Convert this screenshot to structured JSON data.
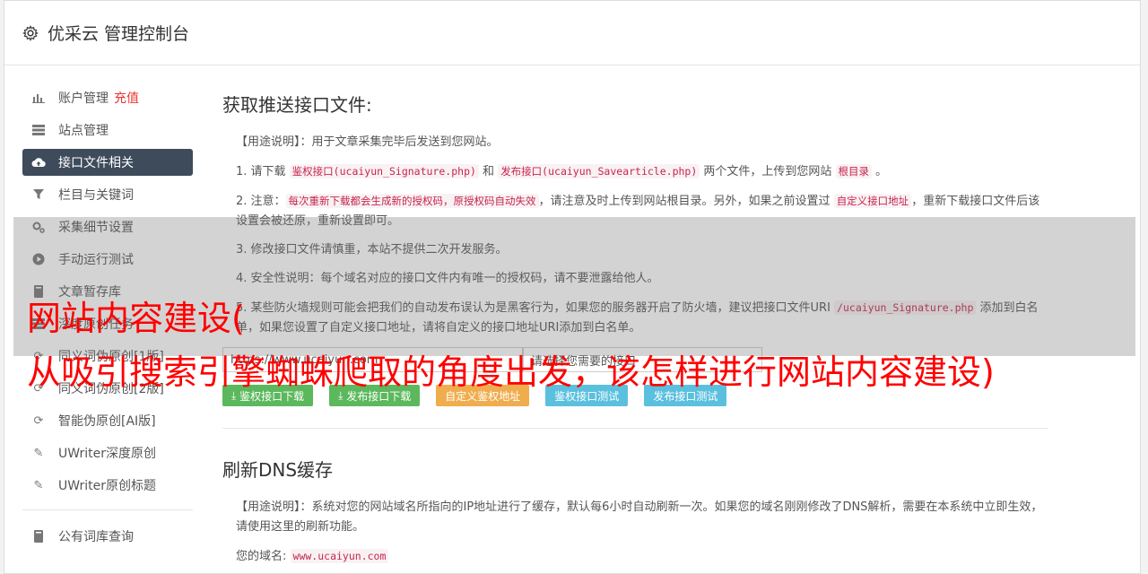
{
  "header": {
    "title": "优采云 管理控制台"
  },
  "sidebar": {
    "items": [
      {
        "label": "账户管理",
        "extra": "充值",
        "icon": "bar-chart-icon"
      },
      {
        "label": "站点管理",
        "icon": "server-icon"
      },
      {
        "label": "接口文件相关",
        "icon": "cloud-upload-icon",
        "active": true
      },
      {
        "label": "栏目与关键词",
        "icon": "filter-icon"
      },
      {
        "label": "采集细节设置",
        "icon": "cogs-icon"
      },
      {
        "label": "手动运行测试",
        "icon": "play-circle-icon"
      },
      {
        "label": "文章暂存库",
        "icon": "book-icon"
      },
      {
        "label": "深度原创任务",
        "icon": "tasks-icon"
      },
      {
        "label": "同义词伪原创[1版]",
        "icon": "refresh-icon"
      },
      {
        "label": "同义词伪原创[2版]",
        "icon": "refresh-icon"
      },
      {
        "label": "智能伪原创[AI版]",
        "icon": "refresh-icon"
      },
      {
        "label": "UWriter深度原创",
        "icon": "edit-icon"
      },
      {
        "label": "UWriter原创标题",
        "icon": "edit-icon"
      },
      {
        "label": "公有词库查询",
        "icon": "book-icon"
      }
    ]
  },
  "section1": {
    "title": "获取推送接口文件:",
    "usage": "【用途说明】：用于文章采集完毕后发送到您网站。",
    "p1": {
      "a": "1. 请下载 ",
      "code1": "鉴权接口(ucaiyun_Signature.php)",
      "b": " 和 ",
      "code2": "发布接口(ucaiyun_Savearticle.php)",
      "c": " 两个文件，上传到您网站 ",
      "code3": "根目录",
      "d": " 。"
    },
    "p2": {
      "a": "2. 注意：",
      "code1": "每次重新下载都会生成新的授权码，原授权码自动失效",
      "b": "，请注意及时上传到网站根目录。另外，如果之前设置过 ",
      "code2": "自定义接口地址",
      "c": "，重新下载接口文件后该设置会被还原，重新设置即可。"
    },
    "p3": "3. 修改接口文件请慎重，本站不提供二次开发服务。",
    "p4": "4. 安全性说明：每个域名对应的接口文件内有唯一的授权码，请不要泄露给他人。",
    "p5": {
      "a": "5. 某些防火墙规则可能会把我们的自动发布误认为是黑客行为，如果您的服务器开启了防火墙，建议把接口文件URI ",
      "code1": "/ucaiyun_Signature.php",
      "b": " 添加到白名单，如果您设置了自定义接口地址，请将自定义的接口地址URI添加到白名单。"
    },
    "input_url": "https://www.ucaiyun.com",
    "input_select": "请选择您需要的接口",
    "buttons": {
      "auth_download": "鉴权接口下载",
      "publish_download": "发布接口下载",
      "custom_auth": "自定义鉴权地址",
      "auth_test": "鉴权接口测试",
      "publish_test": "发布接口测试"
    }
  },
  "section2": {
    "title": "刷新DNS缓存",
    "usage": "【用途说明】：系统对您的网站域名所指向的IP地址进行了缓存，默认每6小时自动刷新一次。如果您的域名刚刚修改了DNS解析，需要在本系统中立即生效，请使用这里的刷新功能。",
    "domain_label": "您的域名:",
    "domain_value": "www.ucaiyun.com"
  },
  "overlay": {
    "line1": "网站内容建设(",
    "line2": "从吸引搜索引擎蜘蛛爬取的角度出发，该怎样进行网站内容建设)"
  },
  "colors": {
    "active_nav": "#3e4b5b",
    "green": "#5cb85c",
    "orange": "#f0ad4e",
    "blue": "#5bc0de",
    "overlay_text": "#ff0000"
  }
}
